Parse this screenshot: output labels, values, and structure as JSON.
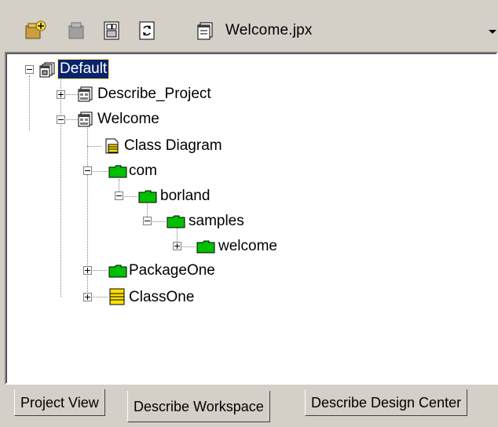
{
  "toolbar": {
    "buttons": [
      {
        "icon": "add-project-icon"
      },
      {
        "icon": "remove-project-icon"
      },
      {
        "icon": "close-project-icon"
      },
      {
        "icon": "refresh-icon"
      }
    ],
    "project_icon": "project-file-icon",
    "current_project": "Welcome.jpx"
  },
  "tree": {
    "root": {
      "label": "Default",
      "selected": true
    },
    "nodes": [
      {
        "label": "Describe_Project"
      },
      {
        "label": "Welcome"
      },
      {
        "label": "Class Diagram"
      },
      {
        "label": "com"
      },
      {
        "label": "borland"
      },
      {
        "label": "samples"
      },
      {
        "label": "welcome"
      },
      {
        "label": "PackageOne"
      },
      {
        "label": "ClassOne"
      }
    ]
  },
  "tabs": {
    "project_view": "Project View",
    "describe_workspace": "Describe Workspace",
    "describe_design_center": "Describe Design Center",
    "active": "Describe Workspace"
  },
  "colors": {
    "selection": "#0a246a",
    "folder": "#00c000",
    "class_icon": "#ffe000"
  }
}
